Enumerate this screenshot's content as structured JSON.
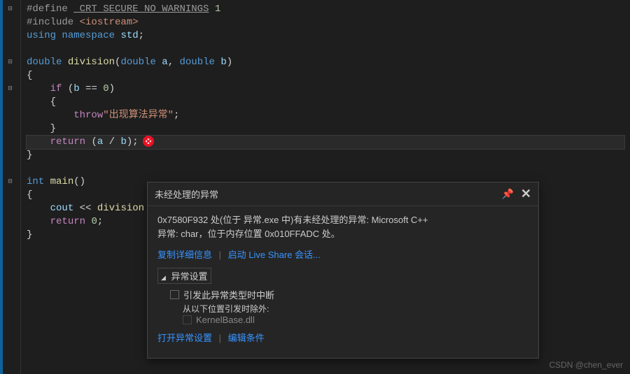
{
  "code": {
    "line1_define": "#define",
    "line1_macro": "_CRT_SECURE_NO_WARNINGS",
    "line1_val": "1",
    "line2_include": "#include",
    "line2_header": "<iostream>",
    "line3_using": "using",
    "line3_namespace": "namespace",
    "line3_std": "std",
    "line5_double": "double",
    "line5_func": "division",
    "line5_p1type": "double",
    "line5_p1": "a",
    "line5_p2type": "double",
    "line5_p2": "b",
    "line7_if": "if",
    "line7_cond_var": "b",
    "line7_cond_op": "==",
    "line7_cond_val": "0",
    "line9_throw": "throw",
    "line9_str": "\"出现算法异常\"",
    "line11_return": "return",
    "line11_a": "a",
    "line11_op": "/",
    "line11_b": "b",
    "line14_int": "int",
    "line14_main": "main",
    "line16_cout": "cout",
    "line16_op": "<<",
    "line16_call": "division",
    "line17_return": "return",
    "line17_val": "0"
  },
  "popup": {
    "title": "未经处理的异常",
    "message_line1": "0x7580F932 处(位于 异常.exe 中)有未经处理的异常: Microsoft C++",
    "message_line2": "异常: char，位于内存位置 0x010FFADC 处。",
    "link_copy": "复制详细信息",
    "link_liveshare": "启动 Live Share 会话...",
    "settings_header": "异常设置",
    "checkbox_label": "引发此异常类型时中断",
    "except_from": "从以下位置引发时除外:",
    "except_dll": "KernelBase.dll",
    "link_open_settings": "打开异常设置",
    "link_edit_condition": "编辑条件"
  },
  "watermark": "CSDN @chen_ever"
}
